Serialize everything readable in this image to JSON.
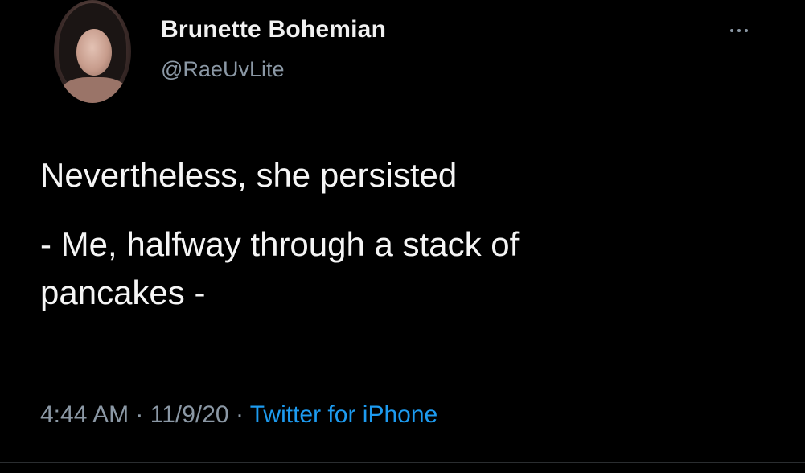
{
  "author": {
    "name": "Brunette Bohemian",
    "handle": "@RaeUvLite"
  },
  "tweet": {
    "line1": "Nevertheless, she persisted",
    "line2": "- Me, halfway through a stack of",
    "line3": "pancakes -"
  },
  "meta": {
    "time": "4:44 AM",
    "sep1": " · ",
    "date": "11/9/20",
    "sep2": " · ",
    "source": "Twitter for iPhone"
  },
  "colors": {
    "background": "#000000",
    "text": "#f5f5f5",
    "muted": "#8b98a5",
    "link": "#1d9bf0"
  },
  "icons": {
    "more": "more-options-icon"
  }
}
